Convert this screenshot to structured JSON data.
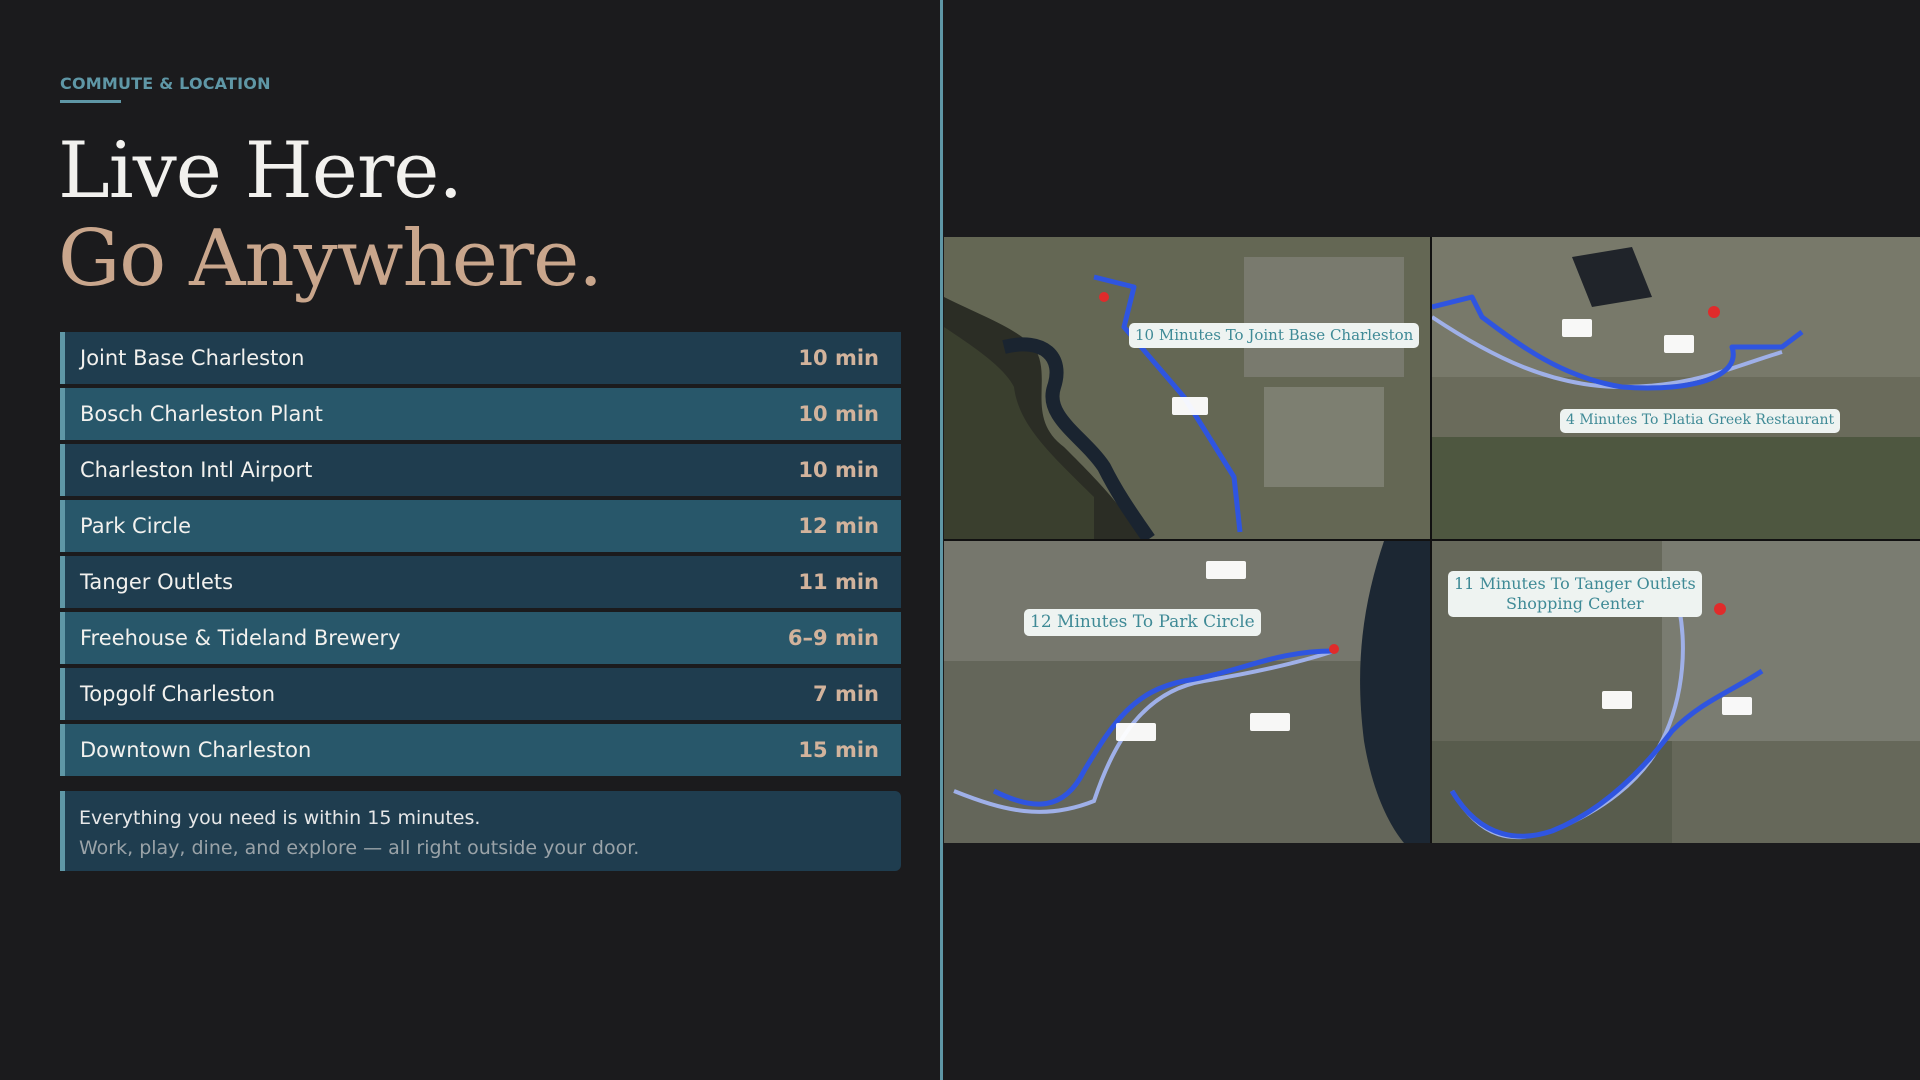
{
  "eyebrow": "COMMUTE & LOCATION",
  "headline": {
    "line1": "Live Here.",
    "line2": "Go Anywhere."
  },
  "destinations": [
    {
      "place": "Joint Base Charleston",
      "time": "10 min"
    },
    {
      "place": "Bosch Charleston Plant",
      "time": "10 min"
    },
    {
      "place": "Charleston Intl Airport",
      "time": "10 min"
    },
    {
      "place": "Park Circle",
      "time": "12 min"
    },
    {
      "place": "Tanger Outlets",
      "time": "11 min"
    },
    {
      "place": "Freehouse & Tideland Brewery",
      "time": "6–9 min"
    },
    {
      "place": "Topgolf Charleston",
      "time": "7 min"
    },
    {
      "place": "Downtown Charleston",
      "time": "15 min"
    }
  ],
  "note": {
    "line1": "Everything you need is within 15 minutes.",
    "line2": "Work, play, dine, and explore — all right outside your door."
  },
  "maps": [
    {
      "label": "10 Minutes To Joint Base Charleston"
    },
    {
      "label": "4 Minutes To Platia Greek Restaurant"
    },
    {
      "label": "12 Minutes To Park Circle"
    },
    {
      "label_line1": "11 Minutes To Tanger Outlets",
      "label_line2": "Shopping Center"
    }
  ],
  "colors": {
    "background": "#1b1b1d",
    "accent": "#5f97a6",
    "gold": "#c9a68c",
    "row_dark": "#1f3d4f",
    "row_light": "#28576a",
    "route": "#2f55e0"
  }
}
